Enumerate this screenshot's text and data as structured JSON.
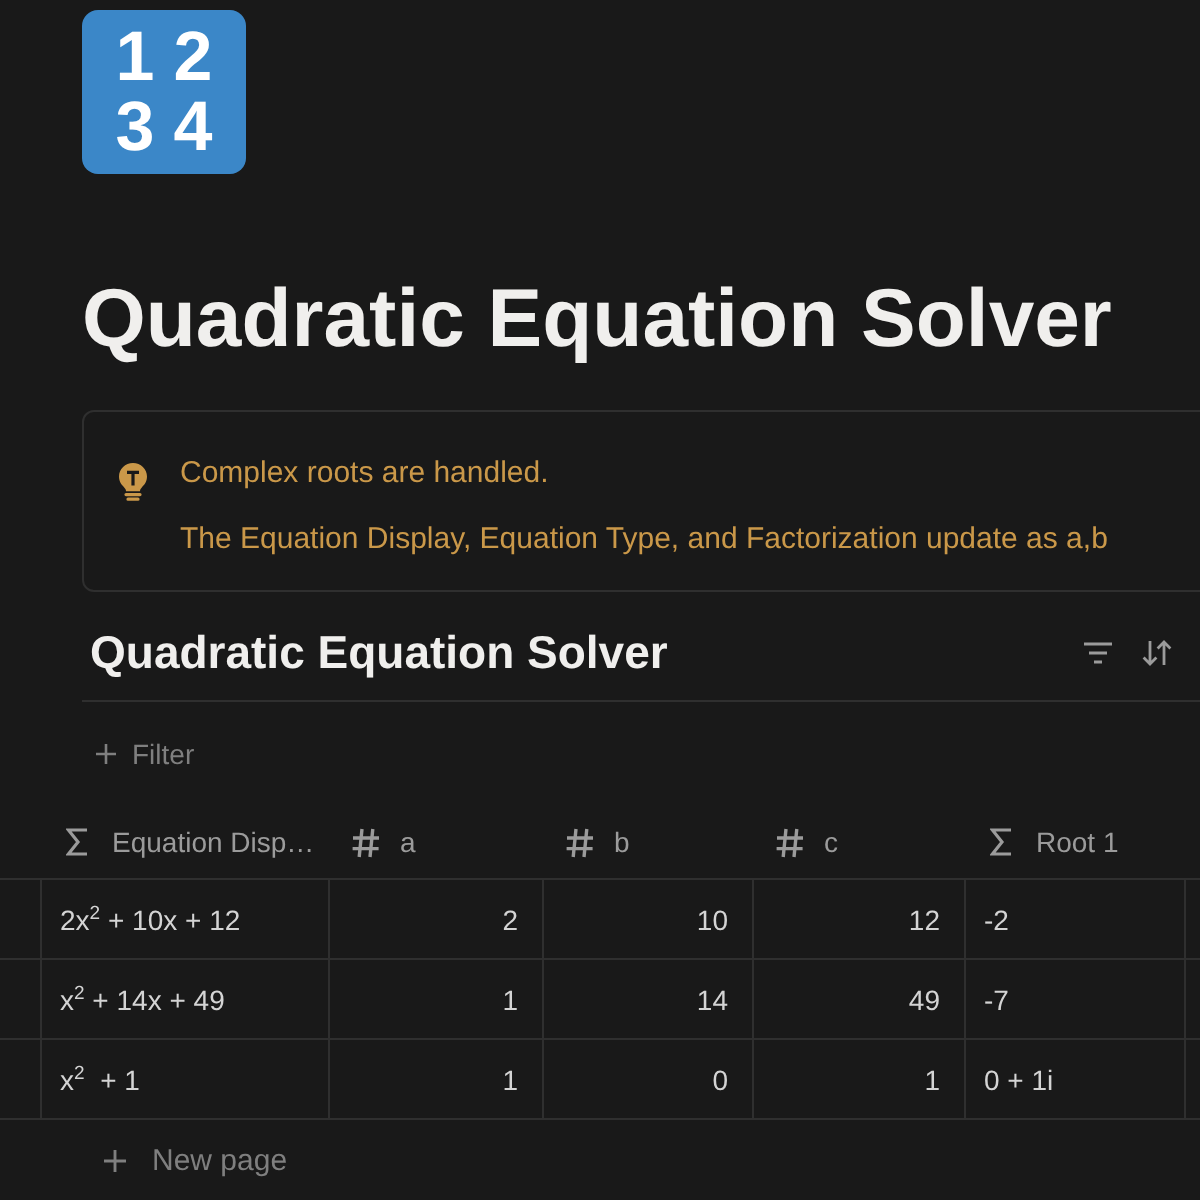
{
  "page": {
    "icon": {
      "digits": [
        "1",
        "2",
        "3",
        "4"
      ]
    },
    "title": "Quadratic Equation Solver"
  },
  "callout": {
    "paragraphs": [
      "Complex roots are handled.",
      "The Equation Display, Equation Type, and Factorization update as a,b"
    ]
  },
  "database": {
    "title": "Quadratic Equation Solver",
    "filter_label": "Filter",
    "columns": [
      {
        "label": "Equation Disp…",
        "kind": "formula"
      },
      {
        "label": "a",
        "kind": "number"
      },
      {
        "label": "b",
        "kind": "number"
      },
      {
        "label": "c",
        "kind": "number"
      },
      {
        "label": "Root 1",
        "kind": "formula"
      }
    ],
    "rows": [
      [
        "2x$^{2}$ + 10x + 12",
        "2",
        "10",
        "12",
        "-2"
      ],
      [
        "x$^{2}$ + 14x + 49",
        "1",
        "14",
        "49",
        "-7"
      ],
      [
        "x$^{2}$  + 1",
        "1",
        "0",
        "1",
        "0 + 1i"
      ]
    ],
    "new_page_label": "New page"
  }
}
